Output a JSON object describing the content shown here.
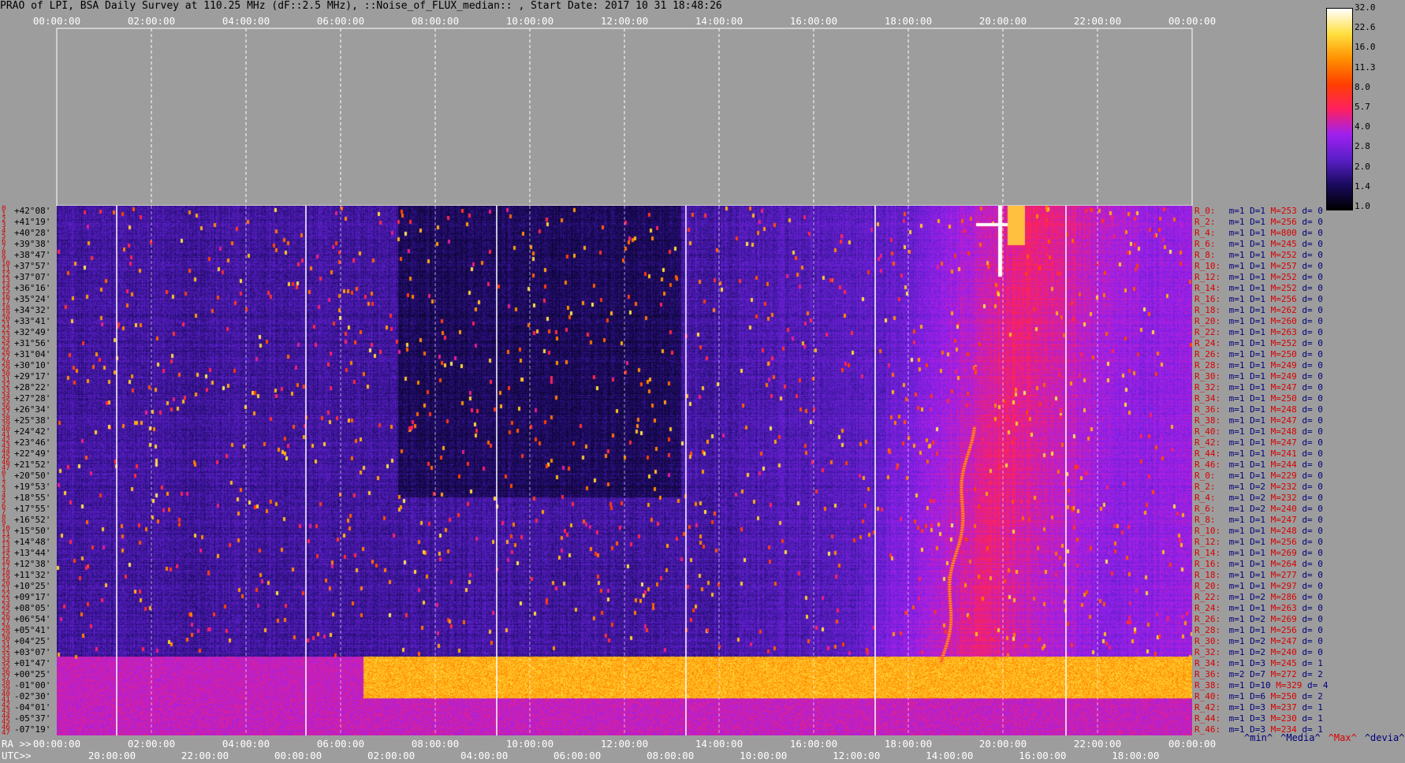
{
  "title": "PRAO of LPI, BSA Daily Survey at 110.25 MHz (dF::2.5 MHz), ::Noise_of_FLUX_median:: , Start Date: 2017 10 31 18:48:26",
  "chart_data": {
    "type": "heatmap",
    "title": "PRAO of LPI, BSA Daily Survey at 110.25 MHz (dF::2.5 MHz), ::Noise_of_FLUX_median:: , Start Date: 2017 10 31 18:48:26",
    "top_axis_ticks": [
      "00:00:00",
      "02:00:00",
      "04:00:00",
      "06:00:00",
      "08:00:00",
      "10:00:00",
      "12:00:00",
      "14:00:00",
      "16:00:00",
      "18:00:00",
      "20:00:00",
      "22:00:00",
      "00:00:00"
    ],
    "ra_axis_label": "RA >>",
    "ra_axis_ticks": [
      "00:00:00",
      "02:00:00",
      "04:00:00",
      "06:00:00",
      "08:00:00",
      "10:00:00",
      "12:00:00",
      "14:00:00",
      "16:00:00",
      "18:00:00",
      "20:00:00",
      "22:00:00",
      "00:00:00"
    ],
    "utc_axis_label": "UTC>>",
    "utc_axis_ticks": [
      "20:00:00",
      "22:00:00",
      "00:00:00",
      "02:00:00",
      "04:00:00",
      "06:00:00",
      "08:00:00",
      "10:00:00",
      "12:00:00",
      "14:00:00",
      "16:00:00",
      "18:00:00"
    ],
    "colorbar_ticks": [
      "32.0",
      "22.6",
      "16.0",
      "11.3",
      "8.0",
      "5.7",
      "4.0",
      "2.8",
      "2.0",
      "1.4",
      "1.0"
    ],
    "colorbar_scale": "log",
    "colorbar_colors": [
      "#000000",
      "#1a0a5e",
      "#5a1fc8",
      "#a020f0",
      "#ff2060",
      "#ff4000",
      "#ff9000",
      "#ffe040",
      "#ffffff"
    ],
    "declinations": [
      "+42°08'",
      "+41°19'",
      "+40°28'",
      "+39°38'",
      "+38°47'",
      "+37°57'",
      "+37°07'",
      "+36°16'",
      "+35°24'",
      "+34°32'",
      "+33°41'",
      "+32°49'",
      "+31°56'",
      "+31°04'",
      "+30°10'",
      "+29°17'",
      "+28°22'",
      "+27°28'",
      "+26°34'",
      "+25°38'",
      "+24°42'",
      "+23°46'",
      "+22°49'",
      "+21°52'",
      "+20°50'",
      "+19°53'",
      "+18°55'",
      "+17°55'",
      "+16°52'",
      "+15°50'",
      "+14°48'",
      "+13°44'",
      "+12°38'",
      "+11°32'",
      "+10°25'",
      "+09°17'",
      "+08°05'",
      "+06°54'",
      "+05°41'",
      "+04°25'",
      "+03°07'",
      "+01°47'",
      "+00°25'",
      "-01°00'",
      "-02°30'",
      "-04°01'",
      "-05°37'",
      "-07°19'"
    ],
    "row_numbers": [
      "0",
      "1",
      "2",
      "3",
      "4",
      "5",
      "6",
      "7",
      "8",
      "9",
      "10",
      "11",
      "12",
      "13",
      "14",
      "15",
      "16",
      "17",
      "18",
      "19",
      "20",
      "21",
      "22",
      "23",
      "24",
      "25",
      "26",
      "27",
      "28",
      "29",
      "30",
      "31",
      "32",
      "33",
      "34",
      "35",
      "36",
      "37",
      "38",
      "39",
      "40",
      "41",
      "42",
      "43",
      "44",
      "45",
      "46",
      "47",
      "0",
      "1",
      "2",
      "3",
      "4",
      "5",
      "6",
      "7",
      "8",
      "9",
      "10",
      "11",
      "12",
      "13",
      "14",
      "15",
      "16",
      "17",
      "18",
      "19",
      "20",
      "21",
      "22",
      "23",
      "24",
      "25",
      "26",
      "27",
      "28",
      "29",
      "30",
      "31",
      "32",
      "33",
      "34",
      "35",
      "36",
      "37",
      "38",
      "39",
      "40",
      "41",
      "42",
      "43",
      "44",
      "45",
      "46",
      "47"
    ],
    "row_stats": [
      {
        "r": "R_0:",
        "m": "m=1",
        "D": "D=1",
        "M": "M=253",
        "d": "d= 0"
      },
      {
        "r": "R_2:",
        "m": "m=1",
        "D": "D=1",
        "M": "M=256",
        "d": "d= 0"
      },
      {
        "r": "R_4:",
        "m": "m=1",
        "D": "D=1",
        "M": "M=800",
        "d": "d= 0"
      },
      {
        "r": "R_6:",
        "m": "m=1",
        "D": "D=1",
        "M": "M=245",
        "d": "d= 0"
      },
      {
        "r": "R_8:",
        "m": "m=1",
        "D": "D=1",
        "M": "M=252",
        "d": "d= 0"
      },
      {
        "r": "R_10:",
        "m": "m=1",
        "D": "D=1",
        "M": "M=257",
        "d": "d= 0"
      },
      {
        "r": "R_12:",
        "m": "m=1",
        "D": "D=1",
        "M": "M=252",
        "d": "d= 0"
      },
      {
        "r": "R_14:",
        "m": "m=1",
        "D": "D=1",
        "M": "M=252",
        "d": "d= 0"
      },
      {
        "r": "R_16:",
        "m": "m=1",
        "D": "D=1",
        "M": "M=256",
        "d": "d= 0"
      },
      {
        "r": "R_18:",
        "m": "m=1",
        "D": "D=1",
        "M": "M=262",
        "d": "d= 0"
      },
      {
        "r": "R_20:",
        "m": "m=1",
        "D": "D=1",
        "M": "M=260",
        "d": "d= 0"
      },
      {
        "r": "R_22:",
        "m": "m=1",
        "D": "D=1",
        "M": "M=263",
        "d": "d= 0"
      },
      {
        "r": "R_24:",
        "m": "m=1",
        "D": "D=1",
        "M": "M=252",
        "d": "d= 0"
      },
      {
        "r": "R_26:",
        "m": "m=1",
        "D": "D=1",
        "M": "M=250",
        "d": "d= 0"
      },
      {
        "r": "R_28:",
        "m": "m=1",
        "D": "D=1",
        "M": "M=249",
        "d": "d= 0"
      },
      {
        "r": "R_30:",
        "m": "m=1",
        "D": "D=1",
        "M": "M=249",
        "d": "d= 0"
      },
      {
        "r": "R_32:",
        "m": "m=1",
        "D": "D=1",
        "M": "M=247",
        "d": "d= 0"
      },
      {
        "r": "R_34:",
        "m": "m=1",
        "D": "D=1",
        "M": "M=250",
        "d": "d= 0"
      },
      {
        "r": "R_36:",
        "m": "m=1",
        "D": "D=1",
        "M": "M=248",
        "d": "d= 0"
      },
      {
        "r": "R_38:",
        "m": "m=1",
        "D": "D=1",
        "M": "M=247",
        "d": "d= 0"
      },
      {
        "r": "R_40:",
        "m": "m=1",
        "D": "D=1",
        "M": "M=248",
        "d": "d= 0"
      },
      {
        "r": "R_42:",
        "m": "m=1",
        "D": "D=1",
        "M": "M=247",
        "d": "d= 0"
      },
      {
        "r": "R_44:",
        "m": "m=1",
        "D": "D=1",
        "M": "M=241",
        "d": "d= 0"
      },
      {
        "r": "R_46:",
        "m": "m=1",
        "D": "D=1",
        "M": "M=244",
        "d": "d= 0"
      },
      {
        "r": "R_0:",
        "m": "m=1",
        "D": "D=1",
        "M": "M=229",
        "d": "d= 0"
      },
      {
        "r": "R_2:",
        "m": "m=1",
        "D": "D=2",
        "M": "M=232",
        "d": "d= 0"
      },
      {
        "r": "R_4:",
        "m": "m=1",
        "D": "D=2",
        "M": "M=232",
        "d": "d= 0"
      },
      {
        "r": "R_6:",
        "m": "m=1",
        "D": "D=2",
        "M": "M=240",
        "d": "d= 0"
      },
      {
        "r": "R_8:",
        "m": "m=1",
        "D": "D=1",
        "M": "M=247",
        "d": "d= 0"
      },
      {
        "r": "R_10:",
        "m": "m=1",
        "D": "D=1",
        "M": "M=248",
        "d": "d= 0"
      },
      {
        "r": "R_12:",
        "m": "m=1",
        "D": "D=1",
        "M": "M=256",
        "d": "d= 0"
      },
      {
        "r": "R_14:",
        "m": "m=1",
        "D": "D=1",
        "M": "M=269",
        "d": "d= 0"
      },
      {
        "r": "R_16:",
        "m": "m=1",
        "D": "D=1",
        "M": "M=264",
        "d": "d= 0"
      },
      {
        "r": "R_18:",
        "m": "m=1",
        "D": "D=1",
        "M": "M=277",
        "d": "d= 0"
      },
      {
        "r": "R_20:",
        "m": "m=1",
        "D": "D=1",
        "M": "M=297",
        "d": "d= 0"
      },
      {
        "r": "R_22:",
        "m": "m=1",
        "D": "D=2",
        "M": "M=286",
        "d": "d= 0"
      },
      {
        "r": "R_24:",
        "m": "m=1",
        "D": "D=1",
        "M": "M=263",
        "d": "d= 0"
      },
      {
        "r": "R_26:",
        "m": "m=1",
        "D": "D=2",
        "M": "M=269",
        "d": "d= 0"
      },
      {
        "r": "R_28:",
        "m": "m=1",
        "D": "D=1",
        "M": "M=256",
        "d": "d= 0"
      },
      {
        "r": "R_30:",
        "m": "m=1",
        "D": "D=2",
        "M": "M=247",
        "d": "d= 0"
      },
      {
        "r": "R_32:",
        "m": "m=1",
        "D": "D=2",
        "M": "M=240",
        "d": "d= 0"
      },
      {
        "r": "R_34:",
        "m": "m=1",
        "D": "D=3",
        "M": "M=245",
        "d": "d= 1"
      },
      {
        "r": "R_36:",
        "m": "m=2",
        "D": "D=7",
        "M": "M=272",
        "d": "d= 2"
      },
      {
        "r": "R_38:",
        "m": "m=1",
        "D": "D=10",
        "M": "M=329",
        "d": "d= 4"
      },
      {
        "r": "R_40:",
        "m": "m=1",
        "D": "D=6",
        "M": "M=250",
        "d": "d= 2"
      },
      {
        "r": "R_42:",
        "m": "m=1",
        "D": "D=3",
        "M": "M=237",
        "d": "d= 1"
      },
      {
        "r": "R_44:",
        "m": "m=1",
        "D": "D=3",
        "M": "M=230",
        "d": "d= 1"
      },
      {
        "r": "R_46:",
        "m": "m=1",
        "D": "D=3",
        "M": "M=234",
        "d": "d= 1"
      }
    ],
    "legend": [
      "^min^",
      "^Media^",
      "^Max^",
      "^devia^"
    ],
    "legend_colors": [
      "#00007a",
      "#00007a",
      "#d80000",
      "#00007a"
    ],
    "colors": {
      "background": "#9d9d9d",
      "grid": "#ffffff",
      "label_red": "#d80000",
      "label_navy": "#00007a"
    }
  }
}
